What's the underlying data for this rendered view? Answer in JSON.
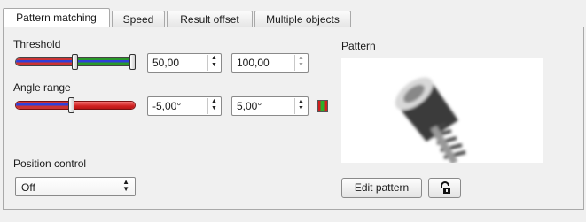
{
  "tabs": [
    {
      "label": "Pattern matching",
      "active": true
    },
    {
      "label": "Speed",
      "active": false
    },
    {
      "label": "Result offset",
      "active": false
    },
    {
      "label": "Multiple objects",
      "active": false
    }
  ],
  "threshold": {
    "label": "Threshold",
    "min_value": "50,00",
    "max_value": "100,00",
    "slider_low_fraction": 0.5,
    "slider_high_fraction": 1.0
  },
  "angle_range": {
    "label": "Angle range",
    "min_value": "-5,00°",
    "max_value": "5,00°",
    "slider_value_fraction": 0.47
  },
  "position_control": {
    "label": "Position control",
    "selected": "Off"
  },
  "pattern": {
    "label": "Pattern",
    "edit_button": "Edit pattern"
  },
  "icons": {
    "lock": "padlock-icon",
    "angle_color_indicator": "color-indicator-icon"
  }
}
